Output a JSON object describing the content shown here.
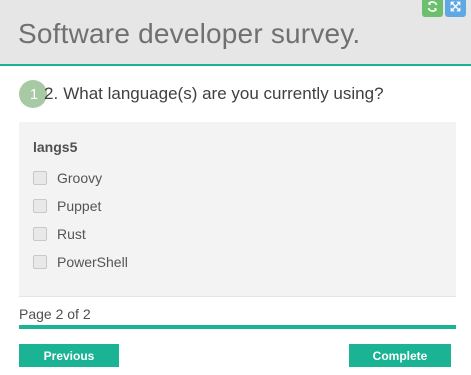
{
  "header": {
    "title": "Software developer survey."
  },
  "question": {
    "badge": "1",
    "number": "2.",
    "text": "What language(s) are you currently using?"
  },
  "panel": {
    "title": "langs5",
    "choices": [
      {
        "label": "Groovy",
        "checked": false
      },
      {
        "label": "Puppet",
        "checked": false
      },
      {
        "label": "Rust",
        "checked": false
      },
      {
        "label": "PowerShell",
        "checked": false
      }
    ]
  },
  "progress": {
    "label": "Page 2 of 2",
    "fraction": 1.0
  },
  "nav": {
    "previous_label": "Previous",
    "complete_label": "Complete"
  },
  "colors": {
    "accent": "#1ab394",
    "badge": "#a7c9a4",
    "header_bg": "#e6e6e6",
    "refresh_button": "#6cc06d",
    "expand_button": "#5fa8e3"
  },
  "icons": {
    "refresh": "refresh-icon",
    "expand": "expand-icon"
  }
}
